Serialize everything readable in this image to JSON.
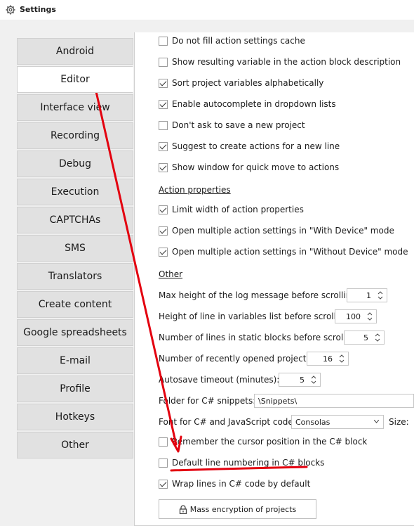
{
  "window": {
    "title": "Settings",
    "icon": "gear-icon"
  },
  "tabs": [
    {
      "label": "Android"
    },
    {
      "label": "Editor"
    },
    {
      "label": "Interface view"
    },
    {
      "label": "Recording"
    },
    {
      "label": "Debug"
    },
    {
      "label": "Execution"
    },
    {
      "label": "CAPTCHAs"
    },
    {
      "label": "SMS"
    },
    {
      "label": "Translators"
    },
    {
      "label": "Create content"
    },
    {
      "label": "Google spreadsheets"
    },
    {
      "label": "E-mail"
    },
    {
      "label": "Profile"
    },
    {
      "label": "Hotkeys"
    },
    {
      "label": "Other"
    }
  ],
  "active_tab": "Editor",
  "editor": {
    "options": [
      {
        "label": "Do not fill action settings cache",
        "checked": false
      },
      {
        "label": "Show resulting variable in the action block description",
        "checked": false
      },
      {
        "label": "Sort project variables alphabetically",
        "checked": true
      },
      {
        "label": "Enable autocomplete in dropdown lists",
        "checked": true
      },
      {
        "label": "Don't ask to save a new project",
        "checked": false
      },
      {
        "label": "Suggest to create actions for a new line",
        "checked": true
      },
      {
        "label": "Show window for quick move to actions",
        "checked": true
      }
    ],
    "action_properties_heading": "Action properties",
    "action_properties": [
      {
        "label": "Limit width of action properties",
        "checked": true
      },
      {
        "label": "Open multiple action settings in \"With Device\" mode",
        "checked": true
      },
      {
        "label": "Open multiple action settings in \"Without Device\" mode",
        "checked": true
      }
    ],
    "other_heading": "Other",
    "numeric": [
      {
        "label": "Max height of the log message before scrolling",
        "value": "1"
      },
      {
        "label": "Height of line in variables list before scrolling",
        "value": "100"
      },
      {
        "label": "Number of lines in static blocks before scrolling",
        "value": "5"
      },
      {
        "label": "Number of recently opened projects",
        "value": "16"
      },
      {
        "label": "Autosave timeout (minutes):",
        "value": "5"
      }
    ],
    "snippets_label": "Folder for C# snippets:",
    "snippets_value": "\\Snippets\\",
    "font_label": "Font for C# and JavaScript code",
    "font_value": "Consolas",
    "size_label": "Size:",
    "bottom_options": [
      {
        "label": "Remember the cursor position in the C# block",
        "checked": false
      },
      {
        "label": "Default line numbering in C# blocks",
        "checked": false
      },
      {
        "label": "Wrap lines in C# code by default",
        "checked": true
      }
    ],
    "encrypt_button": "Mass encryption of projects",
    "encrypt_icon": "lock-icon"
  },
  "annotation": {
    "color": "#e3000f"
  }
}
